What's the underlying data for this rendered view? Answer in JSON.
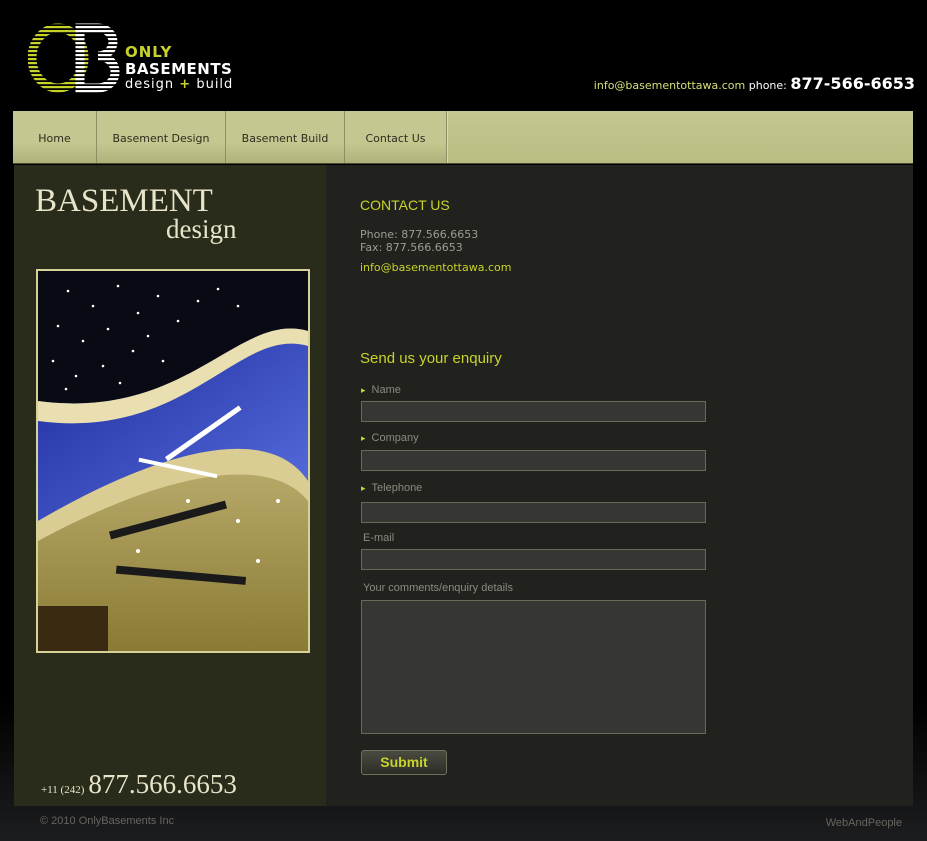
{
  "header": {
    "logo": {
      "line1": "ONLY",
      "line2": "BASEMENTS",
      "line3_a": "design",
      "line3_plus": "+",
      "line3_b": "build"
    },
    "email": "info@basementottawa.com",
    "phone_label": "phone:",
    "phone": "877-566-6653"
  },
  "nav": {
    "items": [
      {
        "label": "Home"
      },
      {
        "label": "Basement Design"
      },
      {
        "label": "Basement Build"
      },
      {
        "label": "Contact Us"
      }
    ]
  },
  "sidebar": {
    "title1": "BASEMENT",
    "title2": "design",
    "phone_prefix": "+11 (242)",
    "phone_number": "877.566.6653"
  },
  "contact": {
    "heading": "CONTACT US",
    "phone": "Phone: 877.566.6653",
    "fax": "Fax: 877.566.6653",
    "email": "info@basementottawa.com"
  },
  "form": {
    "heading": "Send us your enquiry",
    "name_label": "Name",
    "company_label": "Company",
    "telephone_label": "Telephone",
    "email_label": "E-mail",
    "comments_label": "Your comments/enquiry details",
    "submit_label": "Submit",
    "required_marker": "▸"
  },
  "footer": {
    "copyright": "© 2010 OnlyBasements Inc",
    "credit": "WebAndPeople"
  },
  "colors": {
    "accent": "#c8d32a",
    "nav_bg": "#c4c890",
    "side_bg": "#2a2c1b",
    "main_bg": "#21221d"
  }
}
